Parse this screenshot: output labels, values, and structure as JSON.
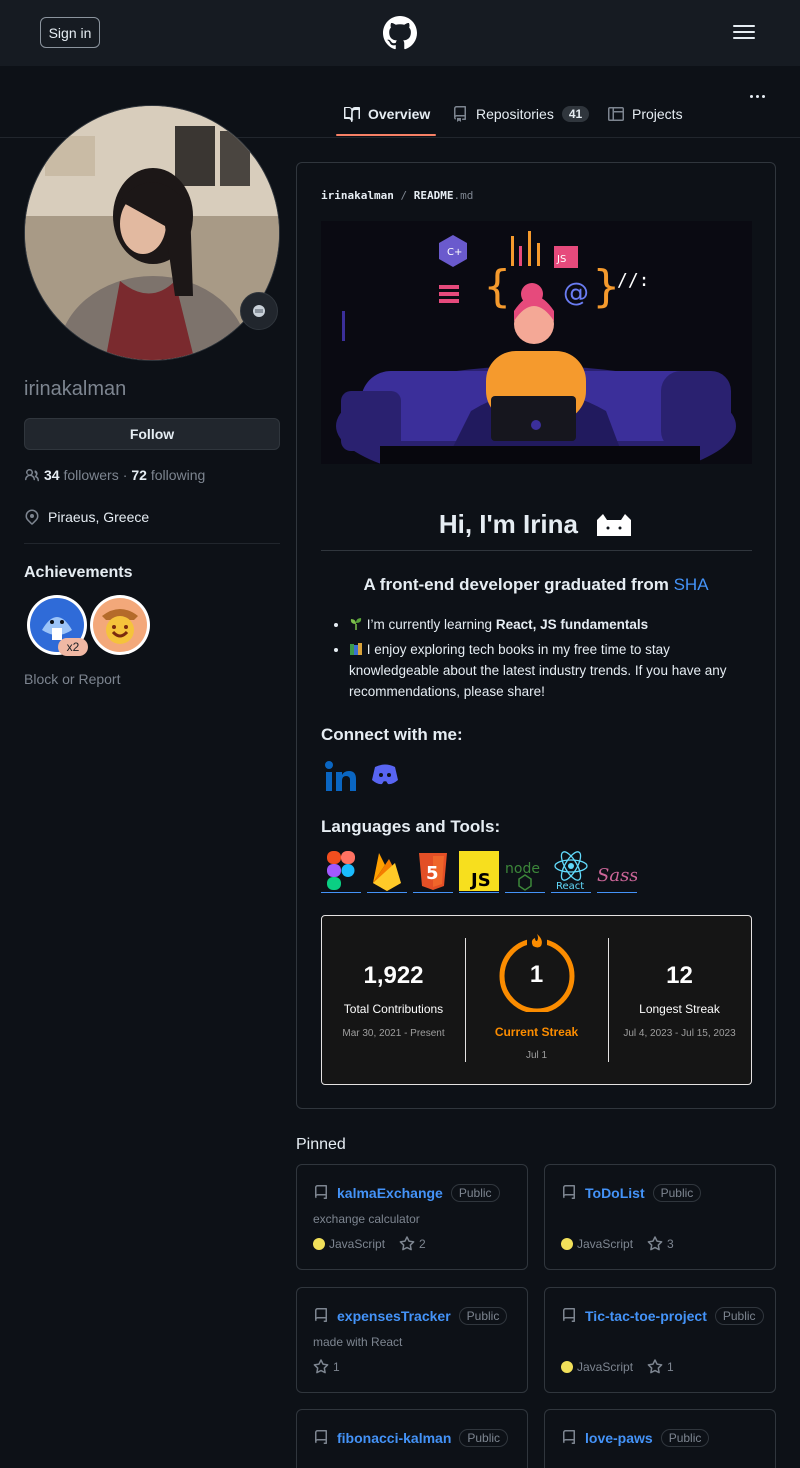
{
  "header": {
    "signin_label": "Sign in"
  },
  "tabs": [
    {
      "label": "Overview"
    },
    {
      "label": "Repositories",
      "count": "41"
    },
    {
      "label": "Projects"
    }
  ],
  "profile": {
    "username": "irinakalman",
    "follow_label": "Follow",
    "followers_count": "34",
    "followers_label": "followers",
    "following_count": "72",
    "following_label": "following",
    "separator": "·",
    "location": "Piraeus, Greece",
    "achievements_title": "Achievements",
    "achievement_count": "x2",
    "block_label": "Block or Report"
  },
  "readme": {
    "owner": "irinakalman",
    "sep": "/",
    "file": "README",
    "ext": ".md",
    "greeting": "Hi, I'm Irina",
    "subtitle": "A front-end developer graduated from",
    "subtitle_link": "SHA",
    "bullet1_prefix": "I’m currently learning",
    "bullet1_bold": "React, JS fundamentals",
    "bullet2": "I enjoy exploring tech books in my free time to stay knowledgeable about the latest industry trends. If you have any recommendations, please share!",
    "connect_title": "Connect with me:",
    "tools_title": "Languages and Tools:",
    "tools": [
      "figma",
      "firebase",
      "html5",
      "javascript",
      "nodejs",
      "react",
      "sass"
    ],
    "streak": {
      "total_value": "1,922",
      "total_label": "Total Contributions",
      "total_range": "Mar 30, 2021 - Present",
      "current_value": "1",
      "current_label": "Current Streak",
      "current_date": "Jul 1",
      "longest_value": "12",
      "longest_label": "Longest Streak",
      "longest_range": "Jul 4, 2023 - Jul 15, 2023"
    }
  },
  "pinned": {
    "title": "Pinned",
    "repos": [
      {
        "name": "kalmaExchange",
        "visibility": "Public",
        "description": "exchange calculator",
        "language": "JavaScript",
        "stars": "2"
      },
      {
        "name": "ToDoList",
        "visibility": "Public",
        "description": "",
        "language": "JavaScript",
        "stars": "3"
      },
      {
        "name": "expensesTracker",
        "visibility": "Public",
        "description": "made with React",
        "language": "",
        "stars": "1"
      },
      {
        "name": "Tic-tac-toe-project",
        "visibility": "Public",
        "description": "",
        "language": "JavaScript",
        "stars": "1"
      },
      {
        "name": "fibonacci-kalman",
        "visibility": "Public",
        "description": "",
        "language": "",
        "stars": ""
      },
      {
        "name": "love-paws",
        "visibility": "Public",
        "description": "",
        "language": "",
        "stars": ""
      }
    ]
  },
  "colors": {
    "accent": "#4493f8",
    "tab_underline": "#f78166",
    "js": "#f1e05a",
    "streak_orange": "#fb8c00"
  }
}
